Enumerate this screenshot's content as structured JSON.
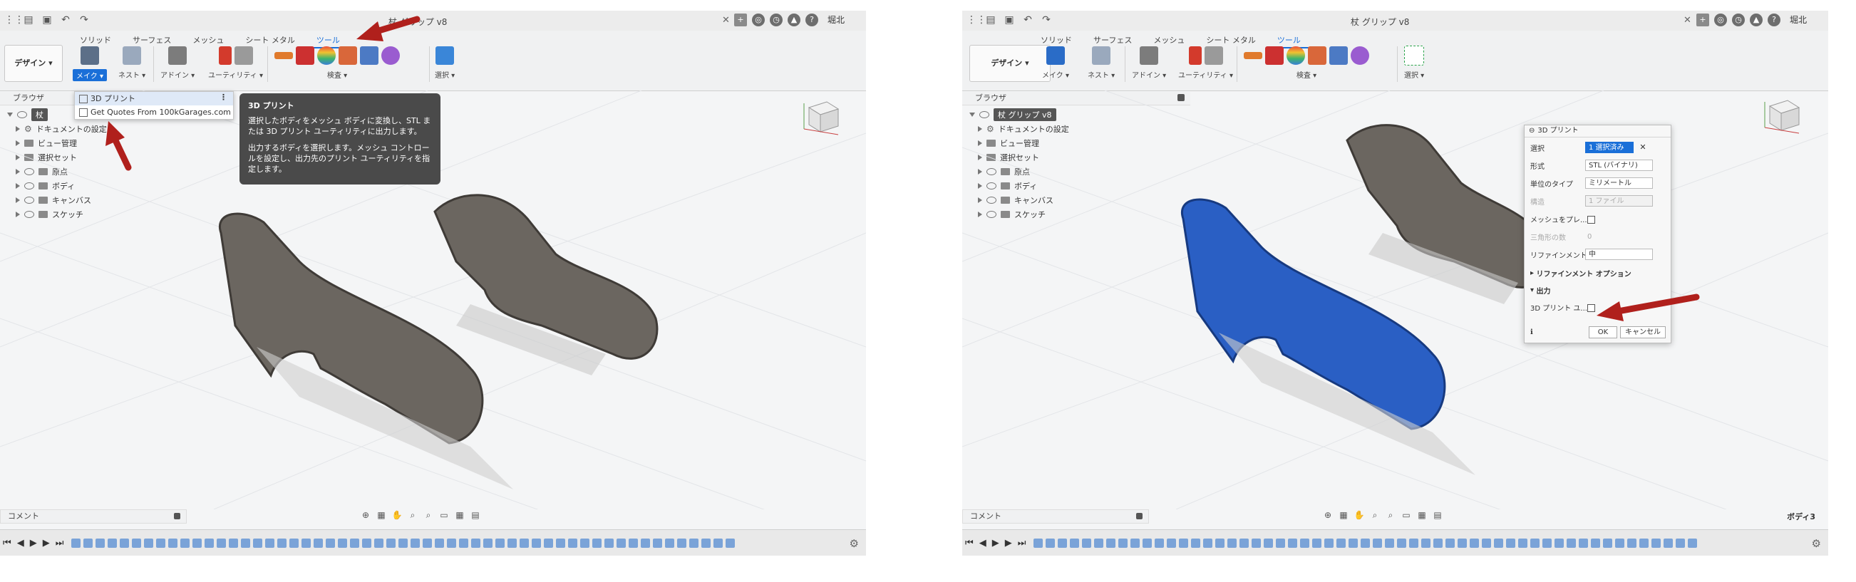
{
  "left": {
    "title": "杖 グリップ v8",
    "user": "堀北",
    "tabs": [
      "ソリッド",
      "サーフェス",
      "メッシュ",
      "シート メタル",
      "ツール"
    ],
    "design_button": "デザイン ▾",
    "groups": {
      "make": "メイク ▾",
      "nest": "ネスト ▾",
      "addin": "アドイン ▾",
      "utility": "ユーティリティ ▾",
      "inspect": "検査 ▾",
      "select": "選択 ▾"
    },
    "browser_label": "ブラウザ",
    "tree": {
      "root": "杖",
      "items": [
        "ドキュメントの設定",
        "ビュー管理",
        "選択セット",
        "原点",
        "ボディ",
        "キャンバス",
        "スケッチ"
      ]
    },
    "dropdown": {
      "item1": "3D プリント",
      "item2": "Get Quotes From 100kGarages.com"
    },
    "tooltip": {
      "title": "3D プリント",
      "p1": "選択したボディをメッシュ ボディに変換し、STL または 3D プリント ユーティリティに出力します。",
      "p2": "出力するボディを選択します。メッシュ コントロールを設定し、出力先のプリント ユーティリティを指定します。"
    },
    "comment": "コメント"
  },
  "right": {
    "title": "杖 グリップ v8",
    "user": "堀北",
    "tabs": [
      "ソリッド",
      "サーフェス",
      "メッシュ",
      "シート メタル",
      "ツール"
    ],
    "design_button": "デザイン ▾",
    "groups": {
      "make": "メイク ▾",
      "nest": "ネスト ▾",
      "addin": "アドイン ▾",
      "utility": "ユーティリティ ▾",
      "inspect": "検査 ▾",
      "select": "選択 ▾"
    },
    "browser_label": "ブラウザ",
    "tree": {
      "root": "杖 グリップ v8",
      "items": [
        "ドキュメントの設定",
        "ビュー管理",
        "選択セット",
        "原点",
        "ボディ",
        "キャンバス",
        "スケッチ"
      ]
    },
    "dialog": {
      "title": "3D プリント",
      "selection_label": "選択",
      "selection_value": "1 選択済み",
      "format_label": "形式",
      "format_value": "STL (バイナリ)",
      "unit_label": "単位のタイプ",
      "unit_value": "ミリメートル",
      "structure_label": "構造",
      "structure_value": "1 ファイル",
      "mesh_preview_label": "メッシュをプレ...",
      "triangles_label": "三角形の数",
      "triangles_value": "0",
      "refinement_label": "リファインメント",
      "refinement_value": "中",
      "refinement_options": "リファインメント オプション",
      "output_label": "出力",
      "print_utility_label": "3D プリント ユ...",
      "ok": "OK",
      "cancel": "キャンセル"
    },
    "comment": "コメント",
    "status": "ボディ3"
  },
  "colors": {
    "accent": "#1a6fd8",
    "arrow": "#b0201c",
    "model_gray": "#6b6660",
    "model_blue": "#2a5fc4",
    "tooltip_bg": "#4a4a4a"
  }
}
